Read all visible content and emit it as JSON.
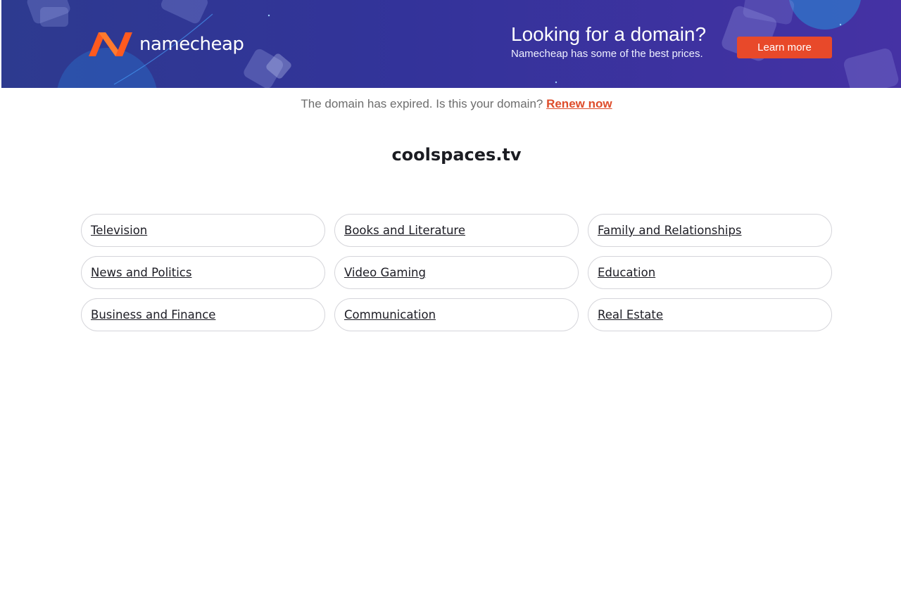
{
  "banner": {
    "logo_text": "namecheap",
    "headline": "Looking for a domain?",
    "subline": "Namecheap has some of the best prices.",
    "cta_label": "Learn more",
    "colors": {
      "background_start": "#2d3a8f",
      "background_end": "#4532a4",
      "cta": "#e8492a",
      "logo_orange": "#ff6a1a"
    }
  },
  "notice": {
    "text": "The domain has expired. Is this your domain? ",
    "link_label": "Renew now"
  },
  "domain_name": "coolspaces.tv",
  "categories": [
    {
      "label": "Television"
    },
    {
      "label": "Books and Literature"
    },
    {
      "label": "Family and Relationships"
    },
    {
      "label": "News and Politics"
    },
    {
      "label": "Video Gaming"
    },
    {
      "label": "Education"
    },
    {
      "label": "Business and Finance"
    },
    {
      "label": "Communication"
    },
    {
      "label": "Real Estate"
    }
  ]
}
